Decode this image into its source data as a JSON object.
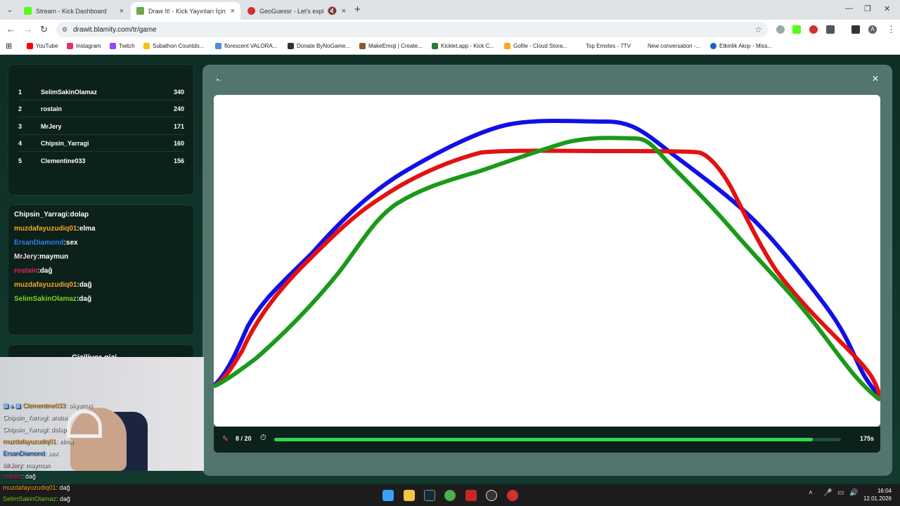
{
  "browser": {
    "tabs": [
      {
        "title": "Stream - Kick Dashboard",
        "favicon_color": "#53fc18"
      },
      {
        "title": "Draw It! - Kick Yayınları İçin Çizi",
        "favicon_color": "#6aa84f"
      },
      {
        "title": "GeoGuessr - Let's explore th",
        "favicon_color": "#d32f2f"
      }
    ],
    "url": "drawit.blamity.com/tr/game",
    "profile_initial": "A",
    "bookmarks": [
      {
        "label": "YouTube",
        "color": "#ff0000"
      },
      {
        "label": "Instagram",
        "color": "#e1306c"
      },
      {
        "label": "Twitch",
        "color": "#9146ff"
      },
      {
        "label": "Subathon Countdo...",
        "color": "#f4c20d"
      },
      {
        "label": "florescent VALORA...",
        "color": "#4a90d9"
      },
      {
        "label": "Donate ByNoGame...",
        "color": "#333333"
      },
      {
        "label": "MakeEmoji | Create...",
        "color": "#8b5a2b"
      },
      {
        "label": "Kicklet.app - Kick C...",
        "color": "#2e7d32"
      },
      {
        "label": "Gofile - Cloud Stora...",
        "color": "#f9a825"
      },
      {
        "label": "Top Emotes - 7TV",
        "color": "#ffffff"
      },
      {
        "label": "New conversation -...",
        "color": "#ffffff"
      },
      {
        "label": "Etkinlik Akışı - Miss...",
        "color": "#1565c0"
      }
    ]
  },
  "leaderboard": [
    {
      "rank": "1",
      "name": "SelimSakinOlamaz",
      "score": "340"
    },
    {
      "rank": "2",
      "name": "rostain",
      "score": "240"
    },
    {
      "rank": "3",
      "name": "MrJery",
      "score": "171"
    },
    {
      "rank": "4",
      "name": "Chipsin_Yarragi",
      "score": "160"
    },
    {
      "rank": "5",
      "name": "Clementine033",
      "score": "156"
    }
  ],
  "chat": [
    {
      "user": "Chipsin_Yarragi",
      "message": "dolap",
      "color": "#ffffff"
    },
    {
      "user": "muzdafayuzudiq01",
      "message": "elma",
      "color": "#f5a623"
    },
    {
      "user": "ErsanDiamond",
      "message": "sex",
      "color": "#2f80ed"
    },
    {
      "user": "MrJery",
      "message": "maymun",
      "color": "#ffd6e7"
    },
    {
      "user": "rostain",
      "message": "dağ",
      "color": "#e0245e"
    },
    {
      "user": "muzdafayuzudiq01",
      "message": "dağ",
      "color": "#f5a623"
    },
    {
      "user": "SelimSakinOlamaz",
      "message": "dağ",
      "color": "#7ed321"
    }
  ],
  "hidden_heading": "Çiziliyor gizi",
  "game": {
    "round": "8 / 20",
    "timer": "175s",
    "progress_fraction": 0.95,
    "stroke_colors": {
      "blue": "#1010e6",
      "red": "#e31212",
      "green": "#1a9a1a"
    }
  },
  "overlay_chat": [
    {
      "user": "Clementine033",
      "message": ": okyanus",
      "color": "#f5a623"
    },
    {
      "user": "Chipsin_Yarragi",
      "message": ": araba",
      "color": "#ffffff"
    },
    {
      "user": "Chipsin_Yarragi",
      "message": ": dolap",
      "color": "#ffffff"
    },
    {
      "user": "muzdafayuzudiq01",
      "message": ": elma",
      "color": "#f5a623"
    },
    {
      "user": "ErsanDiamond",
      "message": ": sex",
      "color": "#2f80ed"
    },
    {
      "user": "MrJery",
      "message": ": maymun",
      "color": "#ffd6e7"
    },
    {
      "user": "rostain",
      "message": ": dağ",
      "color": "#e0245e"
    },
    {
      "user": "muzdafayuzudiq01",
      "message": ": dağ",
      "color": "#f5a623"
    },
    {
      "user": "SelimSakinOlamaz",
      "message": ": dağ",
      "color": "#7ed321"
    }
  ],
  "taskbar": {
    "time": "16:04",
    "date": "12.01.2026"
  }
}
